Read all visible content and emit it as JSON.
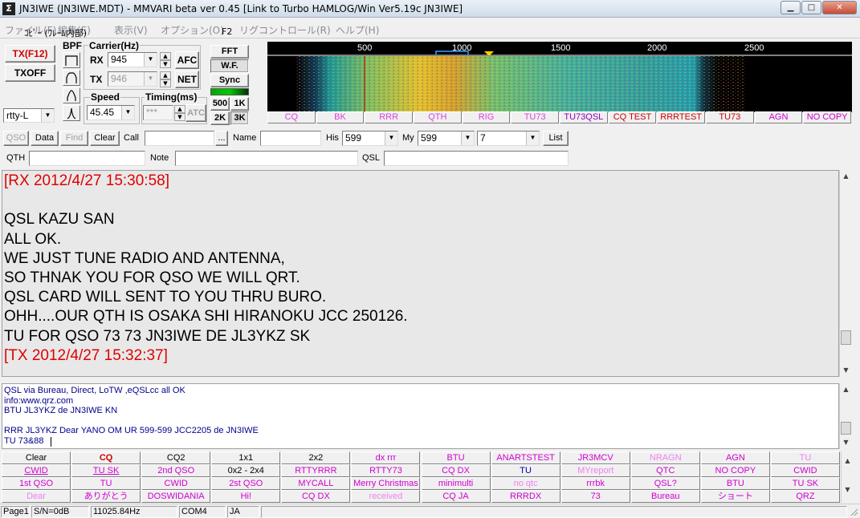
{
  "window": {
    "title": "JN3IWE (JN3IWE.MDT) - MMVARI beta ver 0.45 [Link to Turbo HAMLOG/Win Ver5.19c JN3IWE]",
    "icon_letter": "Σ",
    "min": "▁",
    "max": "□",
    "close": "✕"
  },
  "menu": {
    "items": [
      "ファイル(F)",
      "編集(E)",
      "表示(V)",
      "オプション(O)",
      "リグコントロール(R)",
      "ヘルプ(H)"
    ],
    "overlay": "ｺﾋﾟｰ (ﾌﾚｰﾑ内部)",
    "f2": "F2"
  },
  "controls": {
    "tx_button": "TX(F12)",
    "txoff_button": "TXOFF",
    "bpf_label": "BPF",
    "mode_value": "rtty-L",
    "carrier_label": "Carrier(Hz)",
    "rx_label": "RX",
    "rx_value": "945",
    "tx_label": "TX",
    "tx_value": "946",
    "afc": "AFC",
    "net": "NET",
    "speed_label": "Speed",
    "speed_value": "45.45",
    "timing_label": "Timing(ms)",
    "timing_value": "***",
    "atc": "ATC",
    "fft": "FFT",
    "wf": "W.F.",
    "sync": "Sync",
    "span_500": "500",
    "span_1k": "1K",
    "span_2k": "2K",
    "span_3k": "3K"
  },
  "waterfall": {
    "ticks": [
      "500",
      "1000",
      "1500",
      "2000",
      "2500"
    ]
  },
  "macros_top": [
    {
      "label": "CQ",
      "color": "#e040e0"
    },
    {
      "label": "BK",
      "color": "#e040e0"
    },
    {
      "label": "RRR",
      "color": "#e040e0"
    },
    {
      "label": "QTH",
      "color": "#e040e0"
    },
    {
      "label": "RIG",
      "color": "#e040e0"
    },
    {
      "label": "TU73",
      "color": "#e040e0"
    },
    {
      "label": "TU73QSL",
      "color": "#9000c0"
    },
    {
      "label": "CQ TEST",
      "color": "#d00000"
    },
    {
      "label": "RRRTEST",
      "color": "#d00000"
    },
    {
      "label": "TU73",
      "color": "#d00000"
    },
    {
      "label": "AGN",
      "color": "#d000d0"
    },
    {
      "label": "NO COPY",
      "color": "#d000d0"
    }
  ],
  "logbar": {
    "qso": "QSO",
    "data": "Data",
    "find": "Find",
    "clear": "Clear",
    "call_label": "Call",
    "call_value": "",
    "ellipsis": "...",
    "name_label": "Name",
    "name_value": "",
    "his_label": "His",
    "his_value": "599",
    "my_label": "My",
    "my_value": "599",
    "band_value": "7",
    "list": "List",
    "qth_label": "QTH",
    "note_label": "Note",
    "qsl_label": "QSL"
  },
  "rx_lines": [
    {
      "text": "[RX 2012/4/27 15:30:58]",
      "red": true
    },
    {
      "text": "",
      "red": false
    },
    {
      "text": "QSL KAZU SAN",
      "red": false
    },
    {
      "text": "ALL OK.",
      "red": false
    },
    {
      "text": "WE JUST TUNE RADIO AND ANTENNA,",
      "red": false
    },
    {
      "text": "SO THNAK YOU FOR QSO WE WILL QRT.",
      "red": false
    },
    {
      "text": "QSL CARD WILL SENT TO YOU THRU BURO.",
      "red": false
    },
    {
      "text": "OHH....OUR QTH IS OSAKA SHI HIRANOKU  JCC 250126.",
      "red": false
    },
    {
      "text": "TU FOR QSO 73 73 JN3IWE DE JL3YKZ SK",
      "red": false
    },
    {
      "text": "[TX 2012/4/27 15:32:37]",
      "red": true
    }
  ],
  "tx_lines": [
    "QSL via Bureau,  Direct, LoTW ,eQSLcc all OK",
    " info:www.qrz.com",
    "BTU JL3YKZ de JN3IWE KN",
    "",
    "RRR JL3YKZ Dear YANO OM UR 599-599 JCC2205 de JN3IWE",
    "TU 73&88"
  ],
  "macro_grid": [
    [
      {
        "l": "Clear",
        "c": "#000"
      },
      {
        "l": "CQ",
        "c": "#d00000",
        "b": true
      },
      {
        "l": "CQ2",
        "c": "#000"
      },
      {
        "l": "1x1",
        "c": "#000"
      },
      {
        "l": "2x2",
        "c": "#000"
      },
      {
        "l": "dx rrr",
        "c": "#d000d0"
      },
      {
        "l": "BTU",
        "c": "#d000d0"
      },
      {
        "l": "ANARTSTEST",
        "c": "#d000d0"
      },
      {
        "l": "JR3MCV",
        "c": "#d000d0"
      },
      {
        "l": "NRAGN",
        "c": "#f080f0"
      },
      {
        "l": "AGN",
        "c": "#d000d0"
      },
      {
        "l": "TU",
        "c": "#f080f0"
      }
    ],
    [
      {
        "l": "CWID",
        "c": "#d000d0",
        "u": true
      },
      {
        "l": "TU SK",
        "c": "#d000d0",
        "u": true
      },
      {
        "l": "2nd QSO",
        "c": "#d000d0"
      },
      {
        "l": "0x2 - 2x4",
        "c": "#000"
      },
      {
        "l": "RTTYRRR",
        "c": "#d000d0"
      },
      {
        "l": "RTTY73",
        "c": "#d000d0"
      },
      {
        "l": "CQ DX",
        "c": "#d000d0"
      },
      {
        "l": "TU",
        "c": "#0000a0"
      },
      {
        "l": "MYreport",
        "c": "#f080f0"
      },
      {
        "l": "QTC",
        "c": "#d000d0"
      },
      {
        "l": "NO COPY",
        "c": "#d000d0"
      },
      {
        "l": "CWID",
        "c": "#d000d0"
      }
    ],
    [
      {
        "l": "1st QSO",
        "c": "#d000d0"
      },
      {
        "l": "TU",
        "c": "#d000d0"
      },
      {
        "l": "CWID",
        "c": "#d000d0"
      },
      {
        "l": "2st QSO",
        "c": "#d000d0"
      },
      {
        "l": "MYCALL",
        "c": "#d000d0"
      },
      {
        "l": "Merry Christmas",
        "c": "#d000d0"
      },
      {
        "l": "minimulti",
        "c": "#d000d0"
      },
      {
        "l": "no qtc",
        "c": "#f080f0"
      },
      {
        "l": "rrrbk",
        "c": "#d000d0"
      },
      {
        "l": "QSL?",
        "c": "#d000d0"
      },
      {
        "l": "BTU",
        "c": "#d000d0"
      },
      {
        "l": "TU SK",
        "c": "#d000d0"
      }
    ],
    [
      {
        "l": "Dear",
        "c": "#f080f0"
      },
      {
        "l": "ありがとう",
        "c": "#d000d0"
      },
      {
        "l": "DOSWIDANIA",
        "c": "#d000d0"
      },
      {
        "l": "Hi!",
        "c": "#d000d0"
      },
      {
        "l": "CQ DX",
        "c": "#d000d0"
      },
      {
        "l": "received",
        "c": "#f080f0"
      },
      {
        "l": "CQ JA",
        "c": "#d000d0"
      },
      {
        "l": "RRRDX",
        "c": "#d000d0"
      },
      {
        "l": "73",
        "c": "#d000d0"
      },
      {
        "l": "Bureau",
        "c": "#d000d0"
      },
      {
        "l": "ショート",
        "c": "#d000d0"
      },
      {
        "l": "QRZ",
        "c": "#d000d0"
      }
    ]
  ],
  "status": {
    "page": "Page1",
    "sn": "S/N=0dB",
    "clock": "11025.84Hz",
    "port": "COM4",
    "lang": "JA"
  },
  "glyphs": {
    "up": "▲",
    "down": "▼",
    "dd": "▼"
  }
}
